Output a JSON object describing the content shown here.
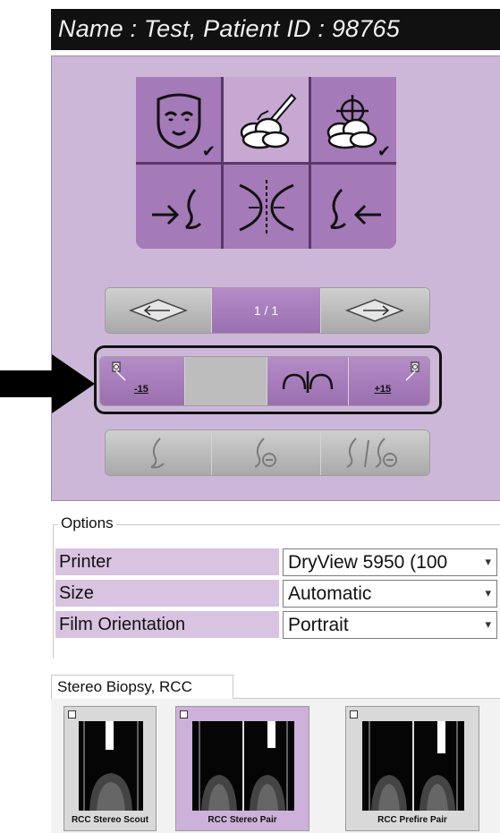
{
  "header": {
    "text": "Name : Test, Patient    ID : 98765"
  },
  "view_tiles": [
    {
      "icon": "face-icon",
      "checked": true
    },
    {
      "icon": "cloud-pencil-icon",
      "checked": false,
      "active": true
    },
    {
      "icon": "cloud-crosshair-icon",
      "checked": true
    },
    {
      "icon": "arrow-to-breast-right-icon",
      "checked": false
    },
    {
      "icon": "mirror-split-icon",
      "checked": false
    },
    {
      "icon": "breast-arrow-left-icon",
      "checked": false
    }
  ],
  "paging": {
    "prev_icon": "arrow-left-icon",
    "page_label": "1 / 1",
    "next_icon": "arrow-right-icon"
  },
  "stereo_bar": {
    "minus_label": "-15",
    "plus_label": "+15",
    "zero_icon": "stereo-zero-icon"
  },
  "breast_bar": {
    "icons": [
      "breast-outline-icon",
      "breast-implant-icon",
      "breast-compare-icon"
    ]
  },
  "options": {
    "legend": "Options",
    "rows": [
      {
        "label": "Printer",
        "value": "DryView 5950 (100"
      },
      {
        "label": "Size",
        "value": "Automatic"
      },
      {
        "label": "Film Orientation",
        "value": "Portrait"
      }
    ],
    "caret": "▾"
  },
  "thumbnails": {
    "tab_label": "Stereo Biopsy, RCC",
    "items": [
      {
        "caption": "RCC Stereo Scout",
        "active": false
      },
      {
        "caption": "RCC Stereo Pair",
        "active": true
      },
      {
        "caption": "RCC Prefire Pair",
        "active": false
      }
    ]
  },
  "colors": {
    "panel": "#cdb7d8",
    "tile": "#a57ab8",
    "tile_active": "#c6a8d2",
    "accent": "#9a6fb0"
  }
}
